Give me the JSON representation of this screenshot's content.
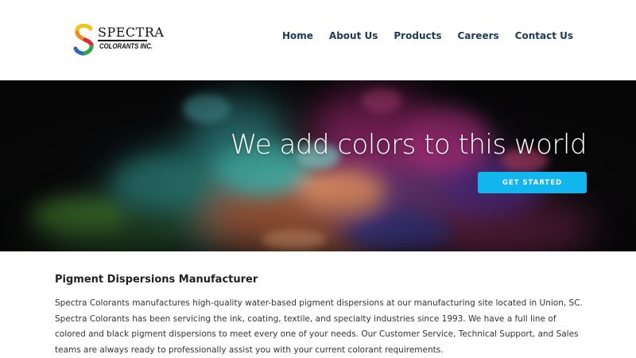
{
  "brand": {
    "name_line1": "SPECTRA",
    "name_line2": "COLORANTS INC."
  },
  "nav": {
    "items": [
      {
        "label": "Home"
      },
      {
        "label": "About Us"
      },
      {
        "label": "Products"
      },
      {
        "label": "Careers"
      },
      {
        "label": "Contact Us"
      }
    ]
  },
  "hero": {
    "headline": "We add colors to this world",
    "cta_label": "GET STARTED"
  },
  "intro": {
    "heading": "Pigment Dispersions Manufacturer",
    "body": "Spectra Colorants manufactures high-quality water-based pigment dispersions at our manufacturing site located in Union, SC. Spectra Colorants has been servicing the ink, coating, textile, and specialty industries since 1993. We have a full line of colored and black pigment dispersions to meet every one of your needs. Our Customer Service, Technical Support, and Sales teams are always ready to professionally assist you with your current colorant requirements."
  },
  "colors": {
    "nav_text": "#1e3a57",
    "cta_background": "#12b6ef",
    "hero_background": "#0d0d0f"
  }
}
